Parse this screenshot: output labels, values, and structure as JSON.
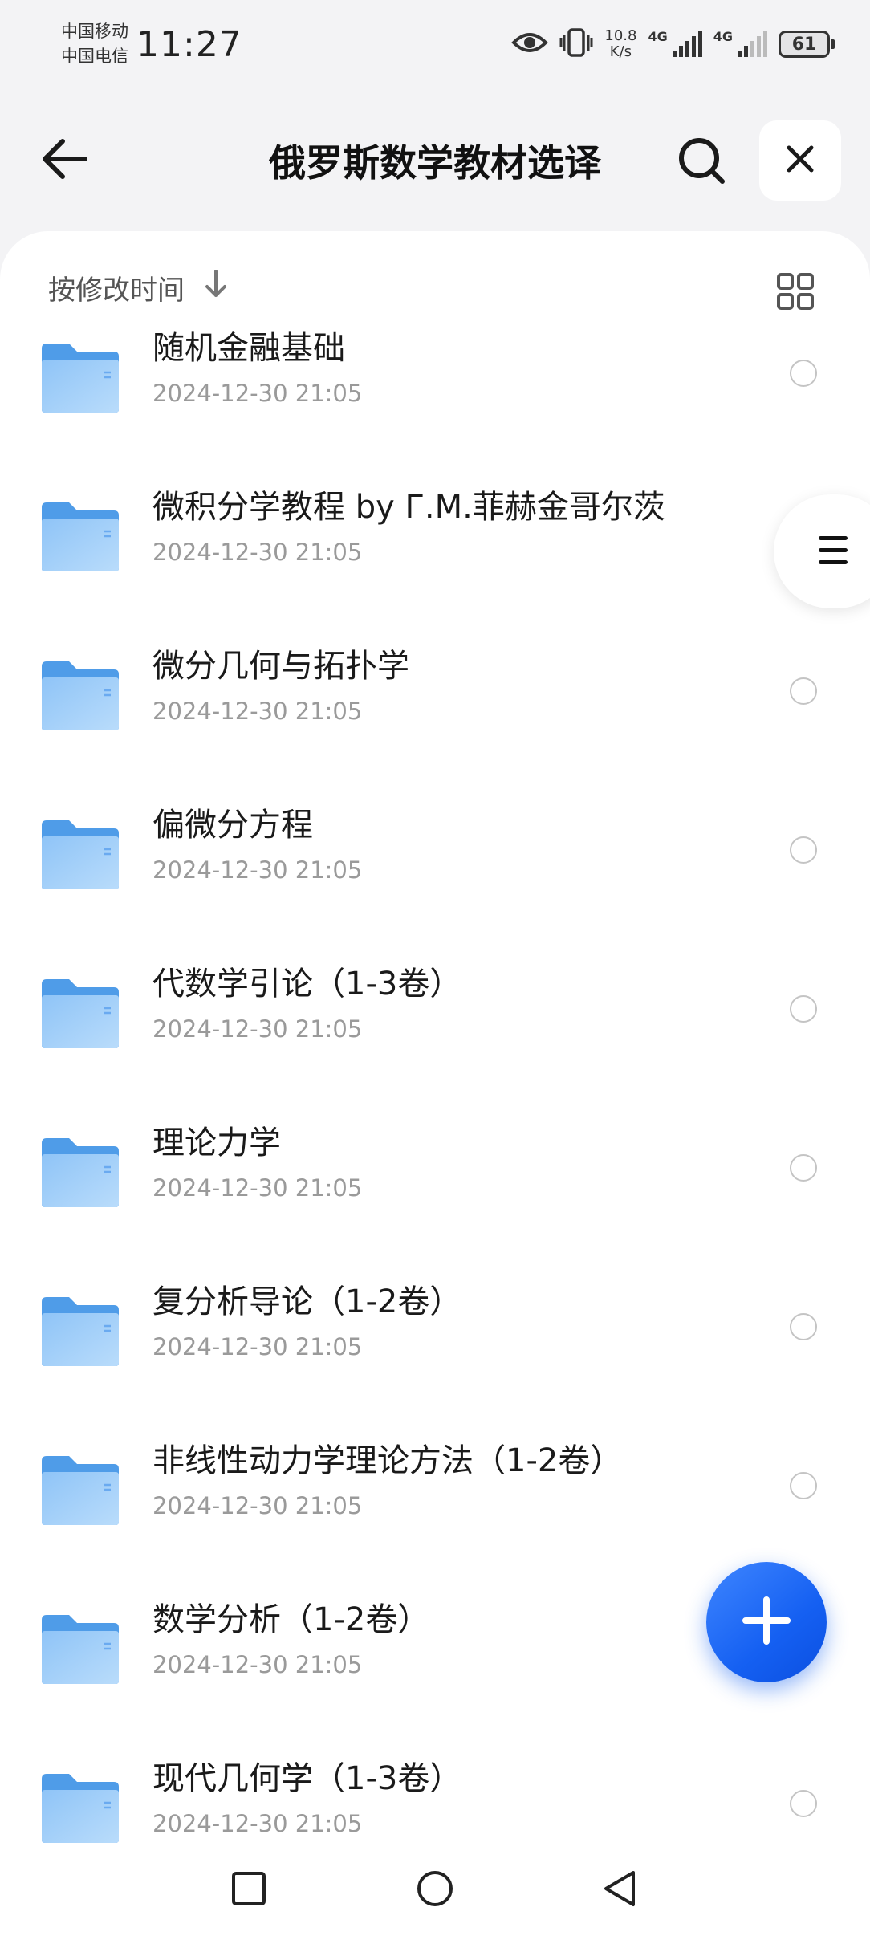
{
  "status_bar": {
    "carrier_1": "中国移动",
    "carrier_2": "中国电信",
    "time": "11:27",
    "net_speed_value": "10.8",
    "net_speed_unit": "K/s",
    "network_1": "4G",
    "network_2": "4G",
    "battery": "61"
  },
  "header": {
    "title": "俄罗斯数学教材选译",
    "back_icon": "arrow-left-icon",
    "search_icon": "search-icon",
    "close_icon": "close-icon"
  },
  "sort": {
    "label": "按修改时间",
    "direction_icon": "arrow-down-icon",
    "view_icon": "grid-view-icon"
  },
  "folders": [
    {
      "name": "随机金融基础",
      "date": "2024-12-30 21:05"
    },
    {
      "name": "微积分学教程 by Г.М.菲赫金哥尔茨",
      "date": "2024-12-30 21:05"
    },
    {
      "name": "微分几何与拓扑学",
      "date": "2024-12-30 21:05"
    },
    {
      "name": "偏微分方程",
      "date": "2024-12-30 21:05"
    },
    {
      "name": "代数学引论（1-3卷）",
      "date": "2024-12-30 21:05"
    },
    {
      "name": "理论力学",
      "date": "2024-12-30 21:05"
    },
    {
      "name": "复分析导论（1-2卷）",
      "date": "2024-12-30 21:05"
    },
    {
      "name": "非线性动力学理论方法（1-2卷）",
      "date": "2024-12-30 21:05"
    },
    {
      "name": "数学分析（1-2卷）",
      "date": "2024-12-30 21:05"
    },
    {
      "name": "现代几何学（1-3卷）",
      "date": "2024-12-30 21:05"
    }
  ],
  "floating": {
    "side_menu_icon": "menu-icon",
    "fab_icon": "plus-icon"
  },
  "colors": {
    "accent": "#1a66f5",
    "folder_blue": "#5aa4f0",
    "background": "#f3f3f5"
  }
}
